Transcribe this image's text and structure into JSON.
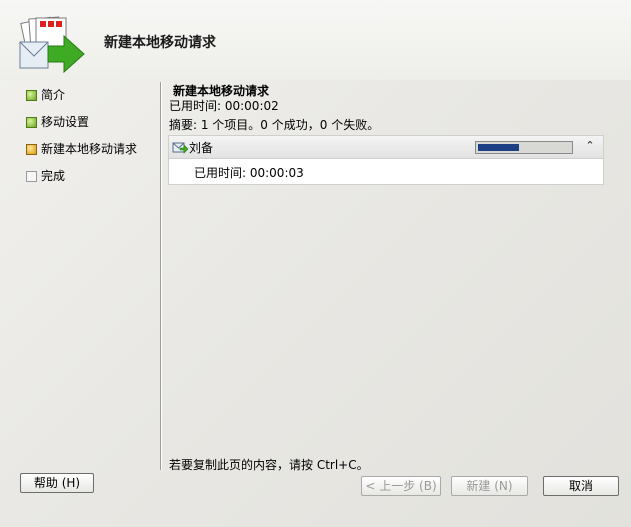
{
  "header": {
    "title": "新建本地移动请求"
  },
  "nav": {
    "items": [
      {
        "label": "简介",
        "status": "green"
      },
      {
        "label": "移动设置",
        "status": "green"
      },
      {
        "label": "新建本地移动请求",
        "status": "amber"
      },
      {
        "label": "完成",
        "status": "gray"
      }
    ]
  },
  "main": {
    "title": "新建本地移动请求",
    "elapsed": "已用时间: 00:00:02",
    "summary": "摘要: 1 个项目。0 个成功，0 个失败。",
    "task": {
      "name": "刘备",
      "elapsed": "已用时间: 00:00:03",
      "progress": 0.45
    },
    "copy_hint": "若要复制此页的内容，请按 Ctrl+C。"
  },
  "buttons": {
    "help": "帮助 (H)",
    "back": "< 上一步 (B)",
    "new": "新建 (N)",
    "cancel": "取消"
  },
  "colors": {
    "progress_fill": "#1d3f84",
    "status_green": "#6ea622",
    "status_amber": "#d99a12"
  }
}
